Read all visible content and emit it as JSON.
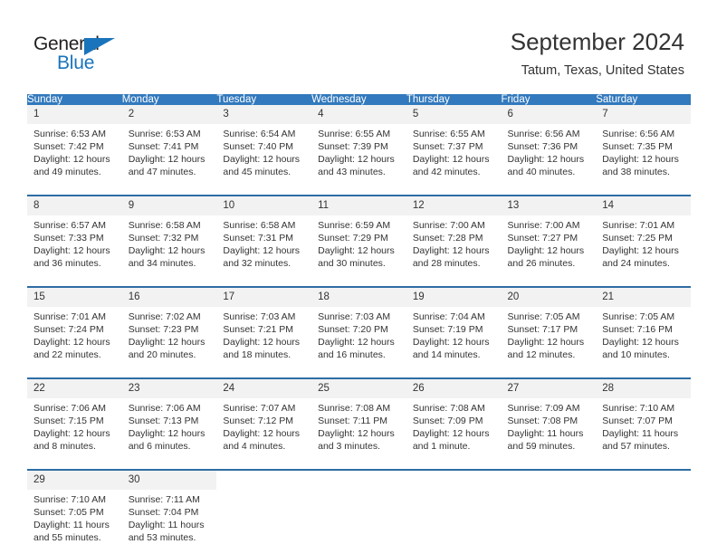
{
  "brand": {
    "name_dark": "General",
    "name_blue": "Blue",
    "accent_color": "#1a74bb"
  },
  "header": {
    "title": "September 2024",
    "subtitle": "Tatum, Texas, United States"
  },
  "colors": {
    "header_blue": "#3279bd",
    "separator_blue": "#2e6da4",
    "daynum_bg": "#f2f2f2",
    "text": "#333333"
  },
  "weekdays": [
    "Sunday",
    "Monday",
    "Tuesday",
    "Wednesday",
    "Thursday",
    "Friday",
    "Saturday"
  ],
  "weeks": [
    [
      {
        "day": "1",
        "sunrise": "Sunrise: 6:53 AM",
        "sunset": "Sunset: 7:42 PM",
        "daylight1": "Daylight: 12 hours",
        "daylight2": "and 49 minutes."
      },
      {
        "day": "2",
        "sunrise": "Sunrise: 6:53 AM",
        "sunset": "Sunset: 7:41 PM",
        "daylight1": "Daylight: 12 hours",
        "daylight2": "and 47 minutes."
      },
      {
        "day": "3",
        "sunrise": "Sunrise: 6:54 AM",
        "sunset": "Sunset: 7:40 PM",
        "daylight1": "Daylight: 12 hours",
        "daylight2": "and 45 minutes."
      },
      {
        "day": "4",
        "sunrise": "Sunrise: 6:55 AM",
        "sunset": "Sunset: 7:39 PM",
        "daylight1": "Daylight: 12 hours",
        "daylight2": "and 43 minutes."
      },
      {
        "day": "5",
        "sunrise": "Sunrise: 6:55 AM",
        "sunset": "Sunset: 7:37 PM",
        "daylight1": "Daylight: 12 hours",
        "daylight2": "and 42 minutes."
      },
      {
        "day": "6",
        "sunrise": "Sunrise: 6:56 AM",
        "sunset": "Sunset: 7:36 PM",
        "daylight1": "Daylight: 12 hours",
        "daylight2": "and 40 minutes."
      },
      {
        "day": "7",
        "sunrise": "Sunrise: 6:56 AM",
        "sunset": "Sunset: 7:35 PM",
        "daylight1": "Daylight: 12 hours",
        "daylight2": "and 38 minutes."
      }
    ],
    [
      {
        "day": "8",
        "sunrise": "Sunrise: 6:57 AM",
        "sunset": "Sunset: 7:33 PM",
        "daylight1": "Daylight: 12 hours",
        "daylight2": "and 36 minutes."
      },
      {
        "day": "9",
        "sunrise": "Sunrise: 6:58 AM",
        "sunset": "Sunset: 7:32 PM",
        "daylight1": "Daylight: 12 hours",
        "daylight2": "and 34 minutes."
      },
      {
        "day": "10",
        "sunrise": "Sunrise: 6:58 AM",
        "sunset": "Sunset: 7:31 PM",
        "daylight1": "Daylight: 12 hours",
        "daylight2": "and 32 minutes."
      },
      {
        "day": "11",
        "sunrise": "Sunrise: 6:59 AM",
        "sunset": "Sunset: 7:29 PM",
        "daylight1": "Daylight: 12 hours",
        "daylight2": "and 30 minutes."
      },
      {
        "day": "12",
        "sunrise": "Sunrise: 7:00 AM",
        "sunset": "Sunset: 7:28 PM",
        "daylight1": "Daylight: 12 hours",
        "daylight2": "and 28 minutes."
      },
      {
        "day": "13",
        "sunrise": "Sunrise: 7:00 AM",
        "sunset": "Sunset: 7:27 PM",
        "daylight1": "Daylight: 12 hours",
        "daylight2": "and 26 minutes."
      },
      {
        "day": "14",
        "sunrise": "Sunrise: 7:01 AM",
        "sunset": "Sunset: 7:25 PM",
        "daylight1": "Daylight: 12 hours",
        "daylight2": "and 24 minutes."
      }
    ],
    [
      {
        "day": "15",
        "sunrise": "Sunrise: 7:01 AM",
        "sunset": "Sunset: 7:24 PM",
        "daylight1": "Daylight: 12 hours",
        "daylight2": "and 22 minutes."
      },
      {
        "day": "16",
        "sunrise": "Sunrise: 7:02 AM",
        "sunset": "Sunset: 7:23 PM",
        "daylight1": "Daylight: 12 hours",
        "daylight2": "and 20 minutes."
      },
      {
        "day": "17",
        "sunrise": "Sunrise: 7:03 AM",
        "sunset": "Sunset: 7:21 PM",
        "daylight1": "Daylight: 12 hours",
        "daylight2": "and 18 minutes."
      },
      {
        "day": "18",
        "sunrise": "Sunrise: 7:03 AM",
        "sunset": "Sunset: 7:20 PM",
        "daylight1": "Daylight: 12 hours",
        "daylight2": "and 16 minutes."
      },
      {
        "day": "19",
        "sunrise": "Sunrise: 7:04 AM",
        "sunset": "Sunset: 7:19 PM",
        "daylight1": "Daylight: 12 hours",
        "daylight2": "and 14 minutes."
      },
      {
        "day": "20",
        "sunrise": "Sunrise: 7:05 AM",
        "sunset": "Sunset: 7:17 PM",
        "daylight1": "Daylight: 12 hours",
        "daylight2": "and 12 minutes."
      },
      {
        "day": "21",
        "sunrise": "Sunrise: 7:05 AM",
        "sunset": "Sunset: 7:16 PM",
        "daylight1": "Daylight: 12 hours",
        "daylight2": "and 10 minutes."
      }
    ],
    [
      {
        "day": "22",
        "sunrise": "Sunrise: 7:06 AM",
        "sunset": "Sunset: 7:15 PM",
        "daylight1": "Daylight: 12 hours",
        "daylight2": "and 8 minutes."
      },
      {
        "day": "23",
        "sunrise": "Sunrise: 7:06 AM",
        "sunset": "Sunset: 7:13 PM",
        "daylight1": "Daylight: 12 hours",
        "daylight2": "and 6 minutes."
      },
      {
        "day": "24",
        "sunrise": "Sunrise: 7:07 AM",
        "sunset": "Sunset: 7:12 PM",
        "daylight1": "Daylight: 12 hours",
        "daylight2": "and 4 minutes."
      },
      {
        "day": "25",
        "sunrise": "Sunrise: 7:08 AM",
        "sunset": "Sunset: 7:11 PM",
        "daylight1": "Daylight: 12 hours",
        "daylight2": "and 3 minutes."
      },
      {
        "day": "26",
        "sunrise": "Sunrise: 7:08 AM",
        "sunset": "Sunset: 7:09 PM",
        "daylight1": "Daylight: 12 hours",
        "daylight2": "and 1 minute."
      },
      {
        "day": "27",
        "sunrise": "Sunrise: 7:09 AM",
        "sunset": "Sunset: 7:08 PM",
        "daylight1": "Daylight: 11 hours",
        "daylight2": "and 59 minutes."
      },
      {
        "day": "28",
        "sunrise": "Sunrise: 7:10 AM",
        "sunset": "Sunset: 7:07 PM",
        "daylight1": "Daylight: 11 hours",
        "daylight2": "and 57 minutes."
      }
    ],
    [
      {
        "day": "29",
        "sunrise": "Sunrise: 7:10 AM",
        "sunset": "Sunset: 7:05 PM",
        "daylight1": "Daylight: 11 hours",
        "daylight2": "and 55 minutes."
      },
      {
        "day": "30",
        "sunrise": "Sunrise: 7:11 AM",
        "sunset": "Sunset: 7:04 PM",
        "daylight1": "Daylight: 11 hours",
        "daylight2": "and 53 minutes."
      },
      {
        "day": "",
        "sunrise": "",
        "sunset": "",
        "daylight1": "",
        "daylight2": ""
      },
      {
        "day": "",
        "sunrise": "",
        "sunset": "",
        "daylight1": "",
        "daylight2": ""
      },
      {
        "day": "",
        "sunrise": "",
        "sunset": "",
        "daylight1": "",
        "daylight2": ""
      },
      {
        "day": "",
        "sunrise": "",
        "sunset": "",
        "daylight1": "",
        "daylight2": ""
      },
      {
        "day": "",
        "sunrise": "",
        "sunset": "",
        "daylight1": "",
        "daylight2": ""
      }
    ]
  ]
}
